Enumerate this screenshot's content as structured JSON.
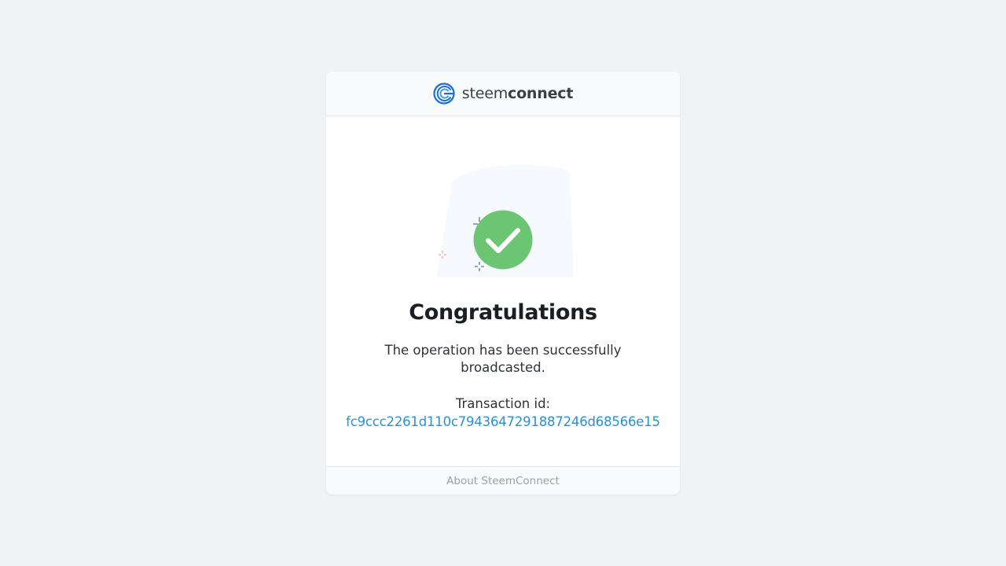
{
  "header": {
    "brand_light": "steem",
    "brand_bold": "connect",
    "logo_icon": "steemconnect-logo-icon"
  },
  "main": {
    "status_icon": "check-circle-icon",
    "title": "Congratulations",
    "message": "The operation has been successfully broadcasted.",
    "transaction_label": "Transaction id:",
    "transaction_id": "fc9ccc2261d110c7943647291887246d68566e15"
  },
  "footer": {
    "about_link": "About SteemConnect"
  },
  "colors": {
    "page_background": "#f1f2f4",
    "success_green": "#6cc573",
    "link_blue": "#2c8fd1",
    "brand_blue": "#1a6fd0"
  }
}
